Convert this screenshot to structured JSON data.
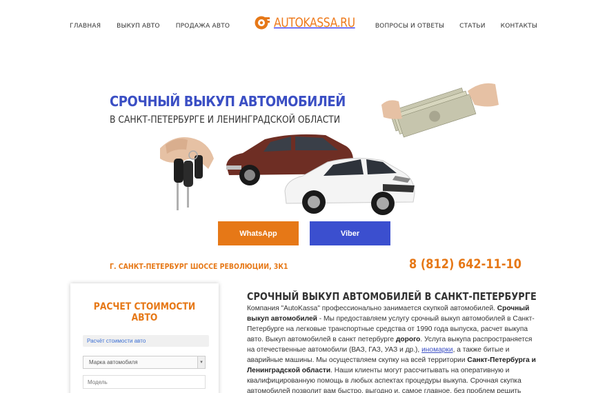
{
  "nav": {
    "left": [
      "ГЛАВНАЯ",
      "ВЫКУП АВТО",
      "ПРОДАЖА АВТО"
    ],
    "right": [
      "ВОПРОСЫ И ОТВЕТЫ",
      "СТАТЬИ",
      "КОНТАКТЫ"
    ]
  },
  "logo": {
    "text": "AUTOKASSA.RU",
    "icon": "wheel-icon"
  },
  "hero": {
    "title": "СРОЧНЫЙ ВЫКУП АВТОМОБИЛЕЙ",
    "subtitle": "В САНКТ-ПЕТЕРБУРГЕ И ЛЕНИНГРАДСКОЙ ОБЛАСТИ",
    "whatsapp_label": "WhatsApp",
    "viber_label": "Viber"
  },
  "contact": {
    "address": "Г. САНКТ-ПЕТЕРБУРГ ШОССЕ РЕВОЛЮЦИИ, 3К1",
    "phone": "8 (812) 642-11-10"
  },
  "calc": {
    "title": "РАСЧЕТ СТОИМОСТИ АВТО",
    "tab_label": "Расчёт стоимости авто",
    "make_select": "Марка автомобиля",
    "model_placeholder": "Модель"
  },
  "article": {
    "title": "СРОЧНЫЙ ВЫКУП АВТОМОБИЛЕЙ В САНКТ-ПЕТЕРБУРГЕ",
    "p1": "Компания \"AutoKassa\" профессионально занимается скупкой автомобилей. ",
    "b1": "Срочный выкуп автомобилей",
    "p2": " - Мы предоставляем услугу срочный выкуп автомобилей в Санкт-Петербурге на легковые транспортные средства от 1990 года выпуска, расчет выкупа авто. Выкуп автомобилей в санкт петербурге ",
    "b2": "дорого",
    "p3": ". Услуга выкупа распространяется на отечественные автомобили (ВАЗ, ГАЗ, УАЗ и др.), ",
    "link": "иномарки",
    "p4": ", а также битые и аварийные машины. Мы осуществляем скупку на всей территории ",
    "b3": "Санкт-Петербурга и Ленинградской области",
    "p5": ". Наши клиенты могут рассчитывать на оперативную и квалифицированную помощь в любых аспектах процедуры выкупа. Срочная скупка автомобилей позволит вам быстро, выгодно и, самое главное, без проблем решить вопрос продажи своего транспортного средства."
  },
  "colors": {
    "accent": "#e67817",
    "brand_blue": "#3b4fc4"
  }
}
